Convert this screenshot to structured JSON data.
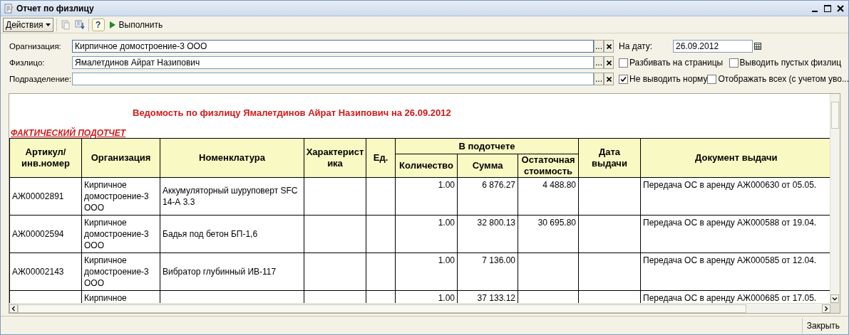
{
  "window": {
    "title": "Отчет по физлицу"
  },
  "toolbar": {
    "actions": "Действия",
    "help": "?",
    "run": "Выполнить"
  },
  "form": {
    "fields": [
      {
        "label": "Орагнизация:",
        "value": "Кирпичное домостроение-3 ООО",
        "focused": true,
        "choose_button": "..."
      },
      {
        "label": "Физлицо:",
        "value": "Ямалетдинов Айрат Назипович",
        "focused": false,
        "choose_button": "..."
      },
      {
        "label": "Подразделение:",
        "focused": false,
        "choose_button": "..."
      }
    ],
    "date": {
      "label": "На дату:",
      "value": "26.09.2012"
    },
    "checkboxes": [
      {
        "label": "Разбивать на страницы",
        "checked": false
      },
      {
        "label": "Выводить пустых физлиц",
        "checked": false
      },
      {
        "label": "Не выводить норму",
        "checked": true
      },
      {
        "label": "Отображать всех (с учетом уво...",
        "checked": false
      }
    ]
  },
  "report": {
    "title": "Ведомость по физлицу Ямалетдинов Айрат Назипович на 26.09.2012",
    "section": "ФАКТИЧЕСКИЙ ПОДОТЧЕТ",
    "columns": [
      {
        "label": "Артикул/ инв.номер"
      },
      {
        "label": "Организация"
      },
      {
        "label": "Номенклатура"
      },
      {
        "label": "Характеристика"
      },
      {
        "label": "Ед."
      },
      {
        "label": "В подотчете",
        "children": [
          {
            "label": "Количество"
          },
          {
            "label": "Сумма"
          },
          {
            "label": "Остаточная стоимость"
          }
        ]
      },
      {
        "label": "Дата выдачи"
      },
      {
        "label": "Документ выдачи"
      }
    ],
    "rows": [
      {
        "article": "АЖ00002891",
        "organization": "Кирпичное домостроение-3 ООО",
        "nomenclature": "Аккумуляторный шуруповерт SFC 14-А  3.3",
        "quantity": "1.00",
        "sum": "6 876.27",
        "residual": "4 488.80",
        "document": "Передача ОС в аренду АЖ000630 от 05.05."
      },
      {
        "article": "АЖ00002594",
        "organization": "Кирпичное домостроение-3 ООО",
        "nomenclature": "Бадья под бетон БП-1,6",
        "quantity": "1.00",
        "sum": "32 800.13",
        "residual": "30 695.80",
        "document": "Передача ОС в аренду АЖ000588 от 19.04."
      },
      {
        "article": "АЖ00002143",
        "organization": "Кирпичное домостроение-3 ООО",
        "nomenclature": "Вибратор глубинный ИВ-117",
        "quantity": "1.00",
        "sum": "7 136.00",
        "document": "Передача ОС в аренду АЖ000585 от 12.04."
      },
      {
        "organization": "Кирпичное",
        "quantity": "1.00",
        "sum": "37 133.12",
        "document": "Передача ОС в аренду АЖ000685 от 17.05."
      }
    ]
  },
  "footer": {
    "close_button": "Закрыть"
  }
}
